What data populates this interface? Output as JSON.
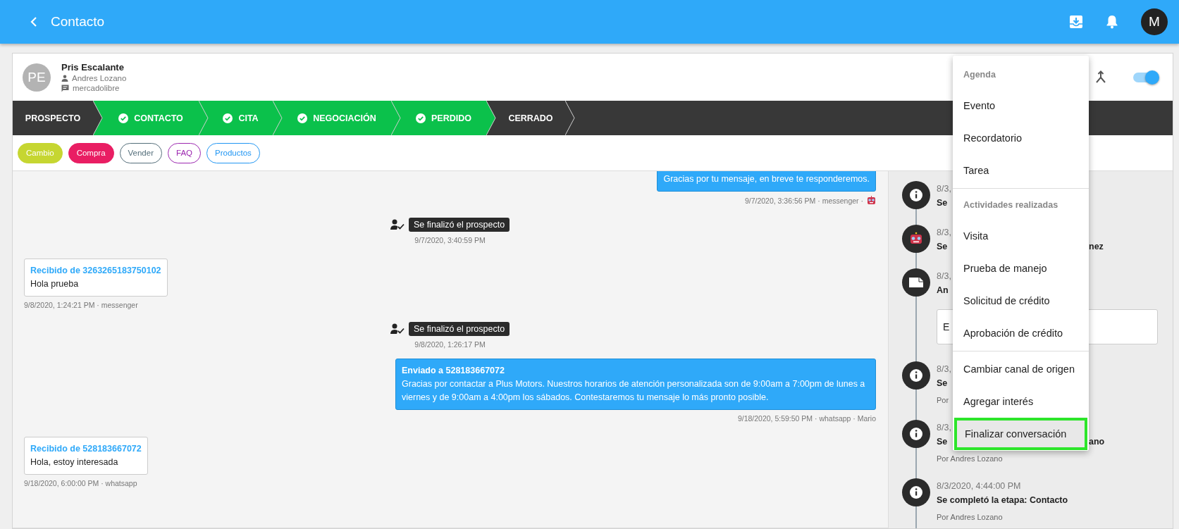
{
  "app_bar": {
    "title": "Contacto",
    "avatar_initial": "M"
  },
  "contact": {
    "initials": "PE",
    "name": "Pris Escalante",
    "agent": "Andres Lozano",
    "channel": "mercadolibre",
    "toggle_on": true
  },
  "stages": [
    {
      "label": "PROSPECTO",
      "done": false
    },
    {
      "label": "CONTACTO",
      "done": true
    },
    {
      "label": "CITA",
      "done": true
    },
    {
      "label": "NEGOCIACIÓN",
      "done": true
    },
    {
      "label": "PERDIDO",
      "done": true
    },
    {
      "label": "CERRADO",
      "done": false
    }
  ],
  "tags": [
    {
      "label": "Cambio",
      "kind": "filled",
      "color": "#c6d631"
    },
    {
      "label": "Compra",
      "kind": "filled",
      "color": "#e91e63"
    },
    {
      "label": "Vender",
      "kind": "outline",
      "color": "#546e7a"
    },
    {
      "label": "FAQ",
      "kind": "outline",
      "color": "#9c27b0"
    },
    {
      "label": "Productos",
      "kind": "outline",
      "color": "#2196f3"
    }
  ],
  "chat": [
    {
      "kind": "sent",
      "cut": true,
      "text": "Gracias por tu mensaje, en breve te responderemos.",
      "meta": "9/7/2020, 3:36:56 PM · messenger ·",
      "bot": true
    },
    {
      "kind": "event",
      "text": "Se finalizó el prospecto",
      "meta": "9/7/2020, 3:40:59 PM"
    },
    {
      "kind": "received",
      "heading": "Recibido de 3263265183750102",
      "text": "Hola prueba",
      "meta": "9/8/2020, 1:24:21 PM · messenger"
    },
    {
      "kind": "event",
      "text": "Se finalizó el prospecto",
      "meta": "9/8/2020, 1:26:17 PM"
    },
    {
      "kind": "sent",
      "cut": false,
      "heading": "Enviado a 528183667072",
      "text": "Gracias por contactar a Plus Motors. Nuestros horarios de atención personalizada son de 9:00am a 7:00pm de lunes a viernes y de 9:00am a 4:00pm los sábados. Contestaremos tu mensaje lo más pronto posible.",
      "meta": "9/18/2020, 5:59:50 PM · whatsapp · Mario",
      "bot": false
    },
    {
      "kind": "received",
      "heading": "Recibido de 528183667072",
      "text": "Hola, estoy interesada",
      "meta": "9/18/2020, 6:00:00 PM · whatsapp"
    }
  ],
  "timeline": [
    {
      "kind": "info",
      "date": "8/3,",
      "title": "Se"
    },
    {
      "kind": "robot",
      "date": "8/3,",
      "title": "Se",
      "title_tail": "nez"
    },
    {
      "kind": "note",
      "date": "8/3,",
      "title": "An",
      "note": "E"
    },
    {
      "kind": "info",
      "date": "8/3,",
      "title": "Se",
      "by": "Por"
    },
    {
      "kind": "info",
      "date": "8/3,",
      "title": "Se",
      "title_tail": "ano",
      "by": "Por Andres Lozano"
    },
    {
      "kind": "info",
      "date": "8/3/2020, 4:44:00 PM",
      "title": "Se completó la etapa: Contacto",
      "by": "Por Andres Lozano"
    }
  ],
  "menu": [
    {
      "header": "Agenda",
      "items": [
        {
          "label": "Evento",
          "selected": false
        },
        {
          "label": "Recordatorio",
          "selected": false
        },
        {
          "label": "Tarea",
          "selected": false
        }
      ]
    },
    {
      "header": "Actividades realizadas",
      "items": [
        {
          "label": "Visita",
          "selected": false
        },
        {
          "label": "Prueba de manejo",
          "selected": false
        },
        {
          "label": "Solicitud de crédito",
          "selected": false
        },
        {
          "label": "Aprobación de crédito",
          "selected": false
        }
      ]
    },
    {
      "items": [
        {
          "label": "Cambiar canal de origen",
          "selected": false
        },
        {
          "label": "Agregar interés",
          "selected": false
        },
        {
          "label": "Finalizar conversación",
          "selected": true
        }
      ]
    }
  ]
}
